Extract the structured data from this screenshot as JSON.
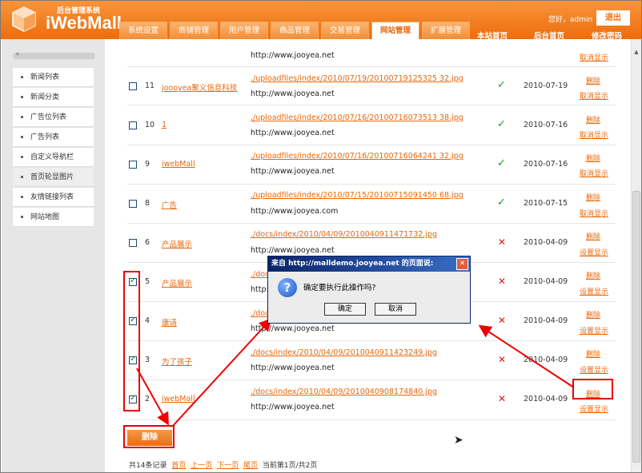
{
  "header": {
    "logo_subtitle": "后台管理系统",
    "logo_name": "iWebMall",
    "greeting": "您好，admin",
    "logout_label": "退出",
    "tabs": [
      "系统设置",
      "商铺管理",
      "用户管理",
      "商品管理",
      "交易管理",
      "网站管理",
      "扩展管理"
    ],
    "active_tab": "网站管理",
    "links": [
      "本站首页",
      "后台首页",
      "修改密码"
    ]
  },
  "sidebar": {
    "items": [
      "新闻列表",
      "新闻分类",
      "广告位列表",
      "广告列表",
      "自定义导航栏",
      "首页轮显图片",
      "友情链接列表",
      "网站地图"
    ],
    "active_item": "首页轮显图片"
  },
  "table": {
    "partial_row": {
      "url": "http://www.jooyea.net",
      "action": "取消显示"
    },
    "rows": [
      {
        "id": "11",
        "name": "joooyea聚义信息科技",
        "image": "./uploadfiles/index/2010/07/19/20100719125325 32.jpg",
        "url": "http://www.jooyea.net",
        "status": "ok",
        "date": "2010-07-19",
        "delete": "删除",
        "toggle": "取消显示",
        "checked": false
      },
      {
        "id": "10",
        "name": "1",
        "image": "./uploadfiles/index/2010/07/16/20100716073513 38.jpg",
        "url": "http://www.jooyea.net",
        "status": "ok",
        "date": "2010-07-16",
        "delete": "删除",
        "toggle": "取消显示",
        "checked": false
      },
      {
        "id": "9",
        "name": "iwebMall",
        "image": "./uploadfiles/index/2010/07/16/20100716064241 32.jpg",
        "url": "http://www.jooyea.net",
        "status": "ok",
        "date": "2010-07-16",
        "delete": "删除",
        "toggle": "取消显示",
        "checked": false
      },
      {
        "id": "8",
        "name": "广告",
        "image": "./uploadfiles/index/2010/07/15/20100715091450 68.jpg",
        "url": "http://www.jooyea.com",
        "status": "ok",
        "date": "2010-07-15",
        "delete": "删除",
        "toggle": "取消显示",
        "checked": false
      },
      {
        "id": "6",
        "name": "产品展示",
        "image": "./docs/index/2010/04/09/2010040911471732.jpg",
        "url": "http://www.jooyea.net",
        "status": "no",
        "date": "2010-04-09",
        "delete": "删除",
        "toggle": "设置显示",
        "checked": false
      },
      {
        "id": "5",
        "name": "产品展示",
        "image": "./docs",
        "url": "http://www.jooyea.net",
        "status": "no",
        "date": "2010-04-09",
        "delete": "删除",
        "toggle": "设置显示",
        "checked": true
      },
      {
        "id": "4",
        "name": "康请",
        "image": "./doc",
        "url": "http://www.jooyea.net",
        "status": "no",
        "date": "2010-04-09",
        "delete": "删除",
        "toggle": "设置显示",
        "checked": true
      },
      {
        "id": "3",
        "name": "为了孩子",
        "image": "./docs/index/2010/04/09/2010040911423249.jpg",
        "url": "http://www.jooyea.net",
        "status": "no",
        "date": "2010-04-09",
        "delete": "删除",
        "toggle": "设置显示",
        "checked": true
      },
      {
        "id": "2",
        "name": "iwebMall",
        "image": "./docs/index/2010/04/09/2010040908174840.jpg",
        "url": "http://www.jooyea.net",
        "status": "no",
        "date": "2010-04-09",
        "delete": "删除",
        "toggle": "设置显示",
        "checked": true
      }
    ]
  },
  "delete_button_label": "删除",
  "pager": {
    "summary": "共14条记录",
    "links": [
      "首页",
      "上一页",
      "下一页",
      "尾页"
    ],
    "current": "当前第1页/共2页"
  },
  "dialog": {
    "title": "来自 http://malldemo.jooyea.net 的页面说:",
    "close_label": "✕",
    "icon_glyph": "?",
    "message": "确定要执行此操作吗?",
    "ok_label": "确定",
    "cancel_label": "取消"
  },
  "colors": {
    "accent": "#ee6e10",
    "annotation": "#ee0000"
  }
}
